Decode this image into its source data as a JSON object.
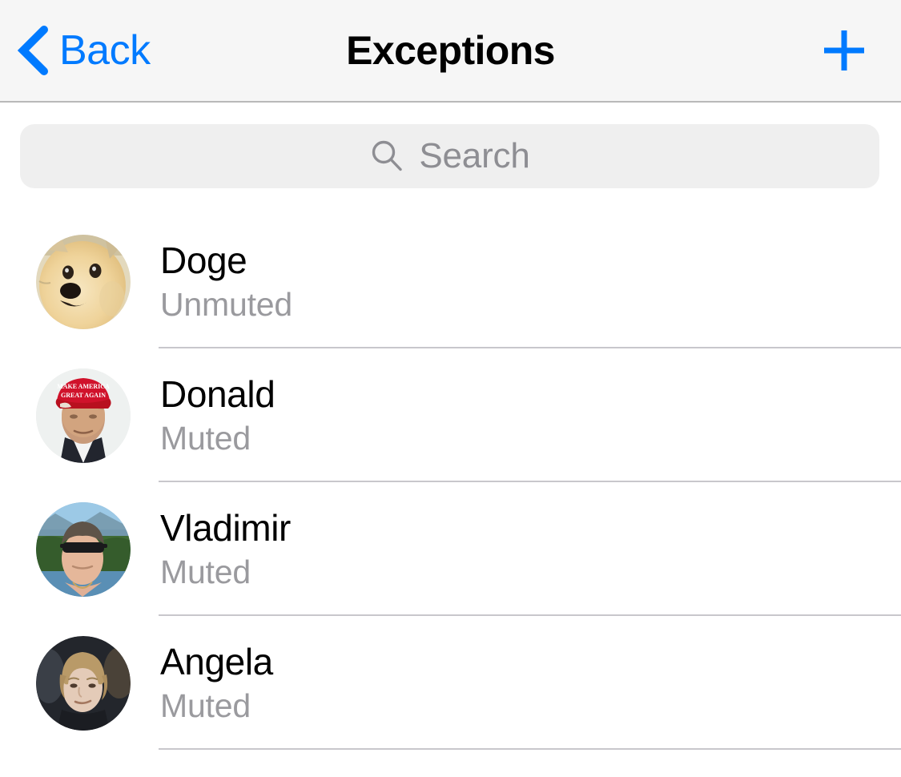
{
  "navbar": {
    "back_label": "Back",
    "back_icon": "chevron-left-icon",
    "title": "Exceptions",
    "add_icon": "plus-icon",
    "accent_color": "#007AFF",
    "background_color": "#F6F6F6"
  },
  "search": {
    "placeholder": "Search",
    "value": "",
    "icon": "search-icon",
    "background_color": "#EFEFEF",
    "text_color": "#8E8E93"
  },
  "list": {
    "separator_color": "#C8C7CC",
    "rows": [
      {
        "name": "Doge",
        "status": "Unmuted",
        "avatar": "avatar-doge"
      },
      {
        "name": "Donald",
        "status": "Muted",
        "avatar": "avatar-donald"
      },
      {
        "name": "Vladimir",
        "status": "Muted",
        "avatar": "avatar-vladimir"
      },
      {
        "name": "Angela",
        "status": "Muted",
        "avatar": "avatar-angela"
      }
    ]
  }
}
